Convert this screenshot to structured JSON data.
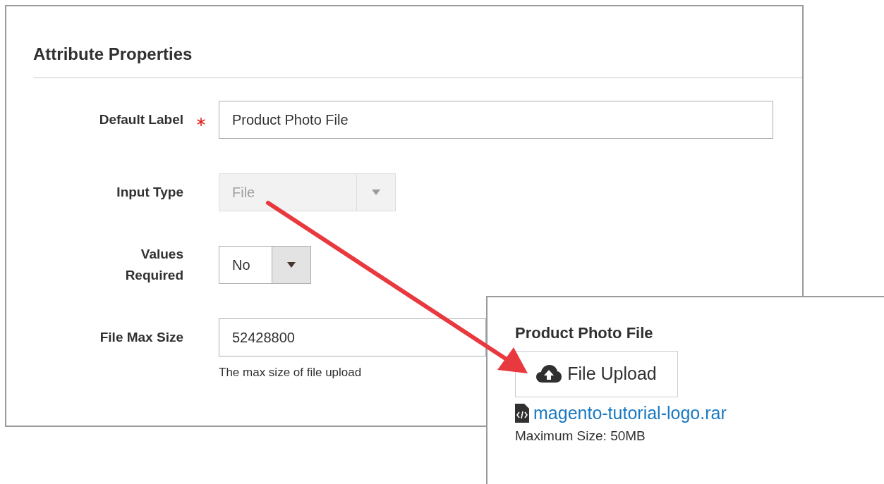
{
  "panel": {
    "title": "Attribute Properties",
    "fields": [
      {
        "kind": "text",
        "label": "Default Label",
        "required": true,
        "disabled": false,
        "value": "Product Photo File"
      },
      {
        "kind": "select",
        "label": "Input Type",
        "required": false,
        "disabled": true,
        "value": "File"
      },
      {
        "kind": "select",
        "label": "Values Required",
        "required": false,
        "disabled": false,
        "value": "No"
      },
      {
        "kind": "text",
        "label": "File Max Size",
        "required": false,
        "disabled": false,
        "value": "52428800",
        "note": "The max size of file upload"
      }
    ]
  },
  "preview": {
    "title": "Product Photo File",
    "button": "File Upload",
    "file_link": "magento-tutorial-logo.rar",
    "max_size": "Maximum Size: 50MB"
  }
}
